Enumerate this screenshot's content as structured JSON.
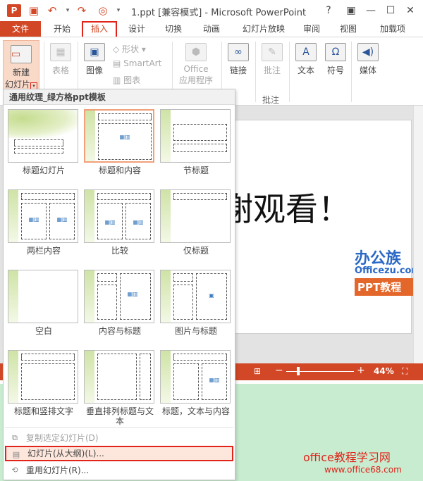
{
  "titlebar": {
    "title": "1.ppt [兼容模式] - Microsoft PowerPoint",
    "logo": "P",
    "help": "?",
    "min": "—",
    "restore": "☐",
    "close": "✕"
  },
  "tabs": {
    "file": "文件",
    "home": "开始",
    "insert": "插入",
    "design": "设计",
    "transitions": "切换",
    "animations": "动画",
    "slideshow": "幻灯片放映",
    "review": "审阅",
    "view": "视图",
    "addins": "加载项"
  },
  "ribbon": {
    "new_slide_line1": "新建",
    "new_slide_line2": "幻灯片",
    "table": "表格",
    "image": "图像",
    "shapes": "形状",
    "smartart": "SmartArt",
    "chart": "图表",
    "office_apps_line1": "Office",
    "office_apps_line2": "应用程序",
    "link": "链接",
    "comment": "批注",
    "comment_group": "批注",
    "text": "文本",
    "symbol": "符号",
    "media": "媒体"
  },
  "slide": {
    "text": "谢观看！",
    "watermark_1": "办公族",
    "watermark_2": "Officezu.com",
    "watermark_3": "PPT教程"
  },
  "status": {
    "zoom": "44%",
    "zoom_minus": "−",
    "zoom_plus": "+",
    "zoom_level": 0.22
  },
  "dropdown": {
    "header": "通用纹理_绿方格ppt模板",
    "layouts": [
      "标题幻灯片",
      "标题和内容",
      "节标题",
      "两栏内容",
      "比较",
      "仅标题",
      "空白",
      "内容与标题",
      "图片与标题",
      "标题和竖排文字",
      "垂直排列标题与文本",
      "标题，文本与内容"
    ],
    "menu": {
      "duplicate": "复制选定幻灯片(D)",
      "from_outline": "幻灯片(从大纲)(L)...",
      "reuse": "重用幻灯片(R)..."
    }
  },
  "footer": {
    "brand": "office教程学习网",
    "url": "www.office68.com"
  }
}
